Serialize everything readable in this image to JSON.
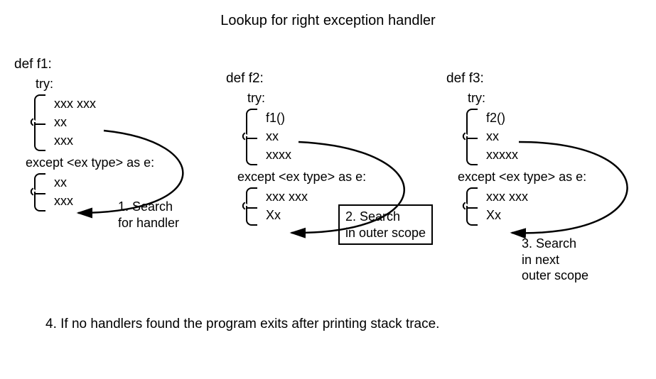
{
  "title": "Lookup for right exception handler",
  "functions": [
    {
      "def": "def f1:",
      "try_kw": "try:",
      "try_body": [
        "xxx xxx",
        "xx",
        "xxx"
      ],
      "except_line": "except <ex type> as e:",
      "except_body": [
        "xx",
        "xxx"
      ]
    },
    {
      "def": "def f2:",
      "try_kw": "try:",
      "try_body": [
        "f1()",
        "xx",
        "xxxx"
      ],
      "except_line": "except <ex type> as e:",
      "except_body": [
        "xxx xxx",
        "Xx"
      ]
    },
    {
      "def": "def f3:",
      "try_kw": "try:",
      "try_body": [
        "f2()",
        "xx",
        "xxxxx"
      ],
      "except_line": "except <ex type> as e:",
      "except_body": [
        "xxx xxx",
        "Xx"
      ]
    }
  ],
  "annotations": {
    "step1_a": "1. Search",
    "step1_b": "for handler",
    "step2_a": "2. Search",
    "step2_b": "in outer scope",
    "step3_a": "3. Search",
    "step3_b": "in next",
    "step3_c": "outer scope"
  },
  "footer": "4. If no handlers found the program exits after printing stack trace."
}
